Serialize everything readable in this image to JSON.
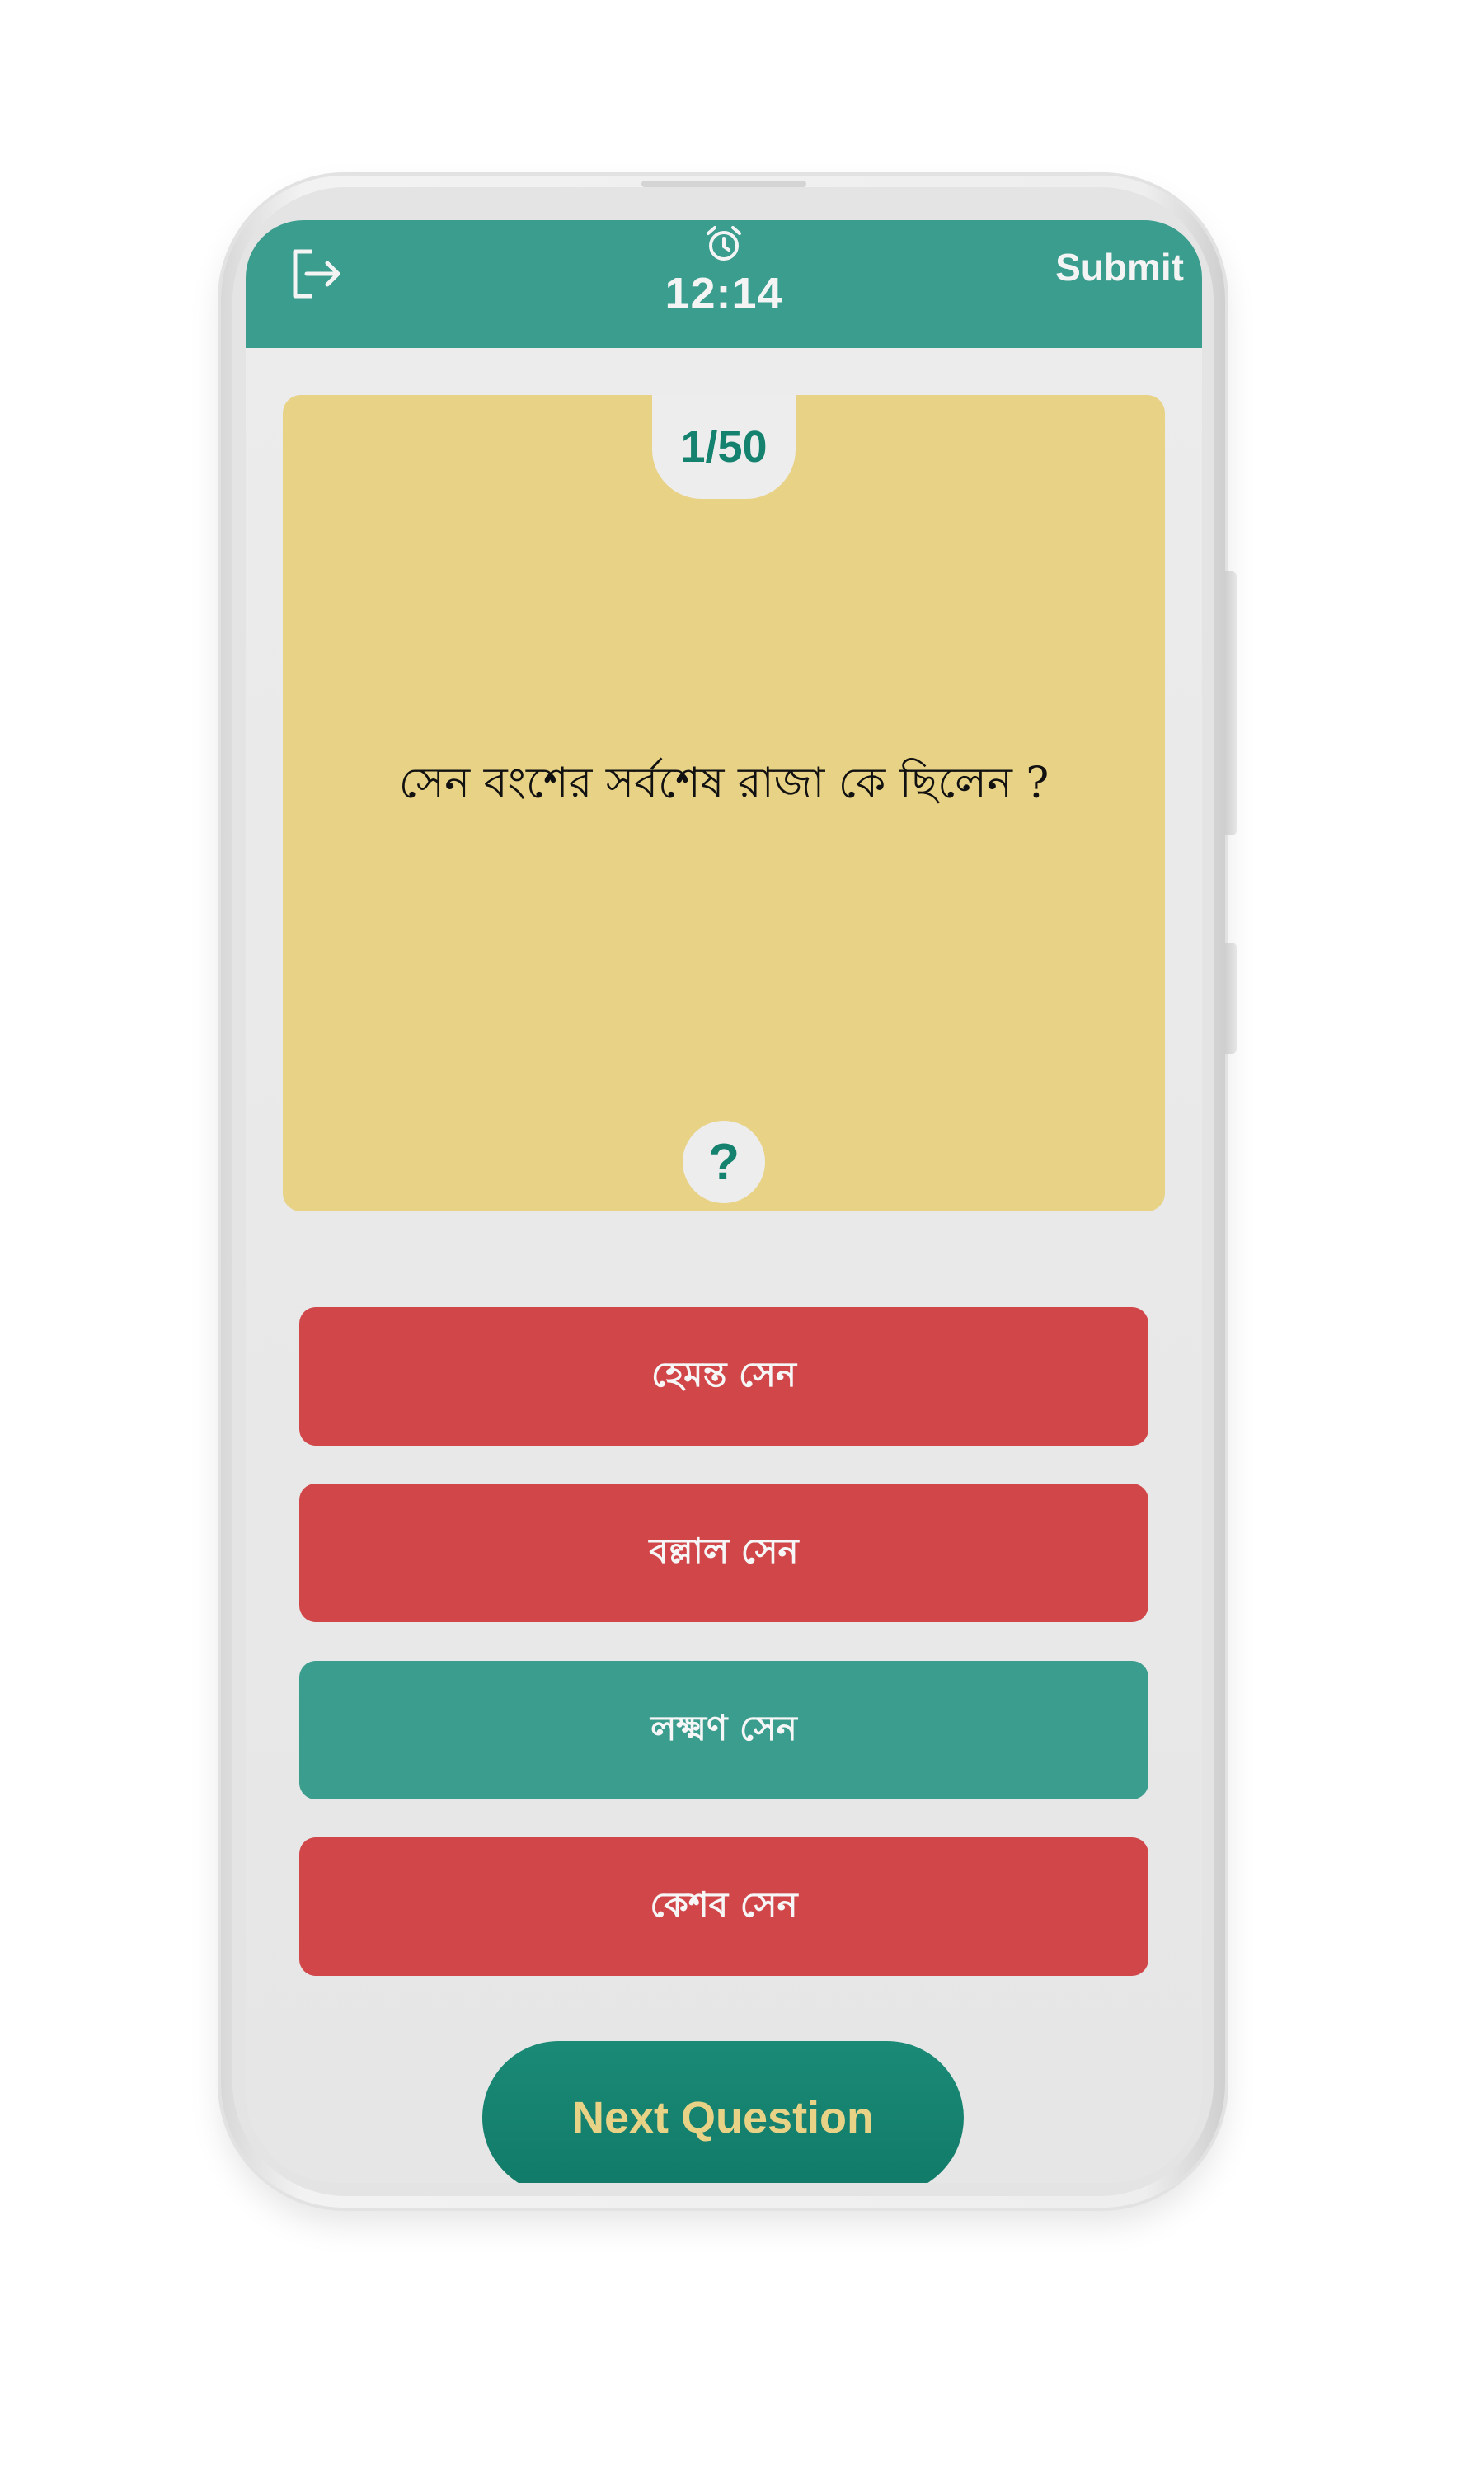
{
  "header": {
    "exit_icon": "exit-icon",
    "alarm_icon": "alarm-clock-icon",
    "timer": "12:14",
    "submit_label": "Submit"
  },
  "question": {
    "counter": "1/50",
    "text": "সেন বংশের সর্বশেষ রাজা কে ছিলেন ?",
    "hint_label": "?"
  },
  "options": [
    {
      "label": "হেমন্ত সেন",
      "state": "wrong"
    },
    {
      "label": "বল্লাল সেন",
      "state": "wrong"
    },
    {
      "label": "লক্ষ্মণ সেন",
      "state": "correct"
    },
    {
      "label": "কেশব সেন",
      "state": "wrong"
    }
  ],
  "next_label": "Next Question",
  "colors": {
    "header": "#3a9d8e",
    "card": "#e8d286",
    "wrong": "#d04649",
    "correct": "#3a9d8e",
    "next_button": "#117a68",
    "next_text": "#e8d286"
  }
}
